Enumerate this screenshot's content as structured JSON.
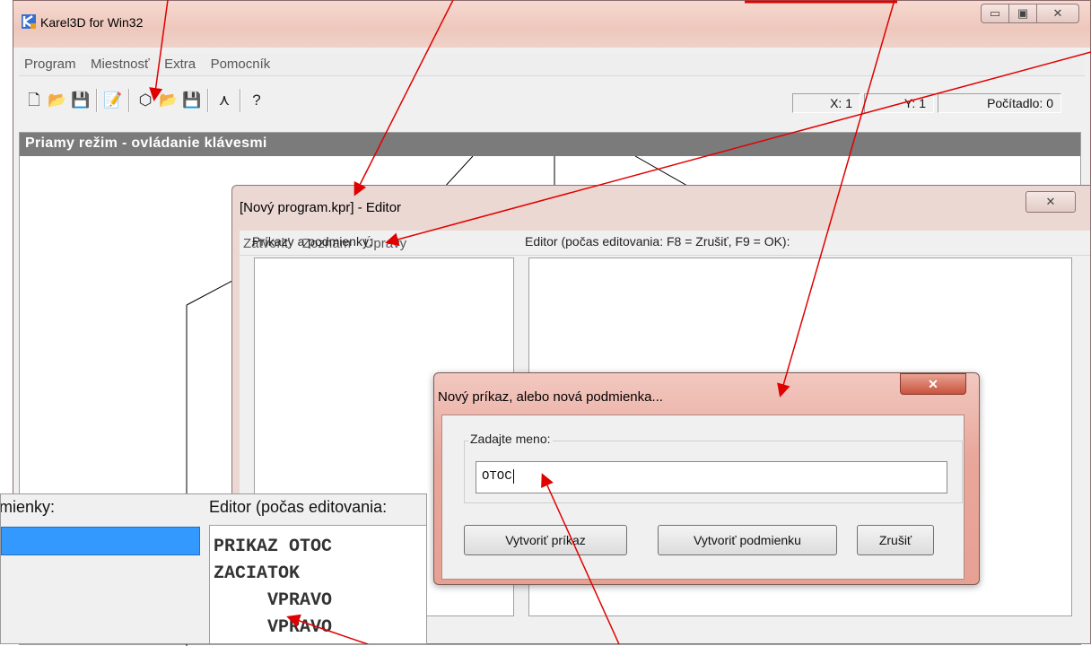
{
  "main_window": {
    "title": "Karel3D for Win32",
    "caption_minimize": "▭",
    "caption_maximize": "▣",
    "caption_close": "✕",
    "menu": [
      "Program",
      "Miestnosť",
      "Extra",
      "Pomocník"
    ],
    "status": {
      "x": "X: 1",
      "y": "Y: 1",
      "counter": "Počítadlo: 0"
    },
    "direct_mode_header": "Priamy režim - ovládanie klávesmi"
  },
  "editor_window": {
    "title": "[Nový program.kpr] - Editor",
    "close": "✕",
    "menu": [
      "Zatvoriť",
      "Zoznam",
      "Úpravy"
    ],
    "commands_label": "Príkazy a podmienky:",
    "editor_label": "Editor (počas editovania: F8 = Zrušiť, F9 = OK):"
  },
  "dialog": {
    "title": "Nový príkaz, alebo nová podmienka...",
    "close": "✕",
    "group_label": "Zadajte meno:",
    "input_value": "OTOC",
    "btn_create_command": "Vytvoriť príkaz",
    "btn_create_condition": "Vytvoriť podmienku",
    "btn_cancel": "Zrušiť"
  },
  "inset": {
    "left_label": "mienky:",
    "right_label": "Editor (počas editovania:",
    "code": [
      "PRIKAZ OTOC",
      "ZACIATOK",
      "     VPRAVO",
      "     VPRAVO"
    ]
  },
  "colors": {
    "annotation_arrow": "#e00000",
    "selection": "#3399ff",
    "header_bar": "#7b7b7b"
  }
}
